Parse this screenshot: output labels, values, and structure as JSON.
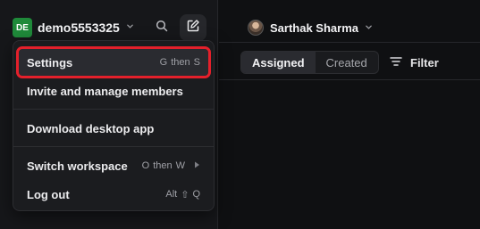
{
  "workspace": {
    "initials": "DE",
    "name": "demo5553325"
  },
  "icons": {
    "search": "search-icon",
    "compose": "compose-icon",
    "chevron": "chevron-down-icon",
    "filter": "filter-icon",
    "submenu": "chevron-right-icon"
  },
  "colors": {
    "badge": "#1f8a3a",
    "highlight_outline": "#e4202b",
    "background": "#101113"
  },
  "menu": {
    "settings": {
      "label": "Settings",
      "shortcut_a": "G",
      "shortcut_then": "then",
      "shortcut_b": "S"
    },
    "invite": {
      "label": "Invite and manage members"
    },
    "download": {
      "label": "Download desktop app"
    },
    "switch_workspace": {
      "label": "Switch workspace",
      "shortcut_a": "O",
      "shortcut_then": "then",
      "shortcut_b": "W"
    },
    "logout": {
      "label": "Log out",
      "shortcut_a": "Alt",
      "shortcut_b": "⇧",
      "shortcut_c": "Q"
    }
  },
  "header": {
    "user_name": "Sarthak Sharma"
  },
  "tabs": [
    {
      "label": "Assigned",
      "active": true
    },
    {
      "label": "Created",
      "active": false
    }
  ],
  "filter_label": "Filter"
}
